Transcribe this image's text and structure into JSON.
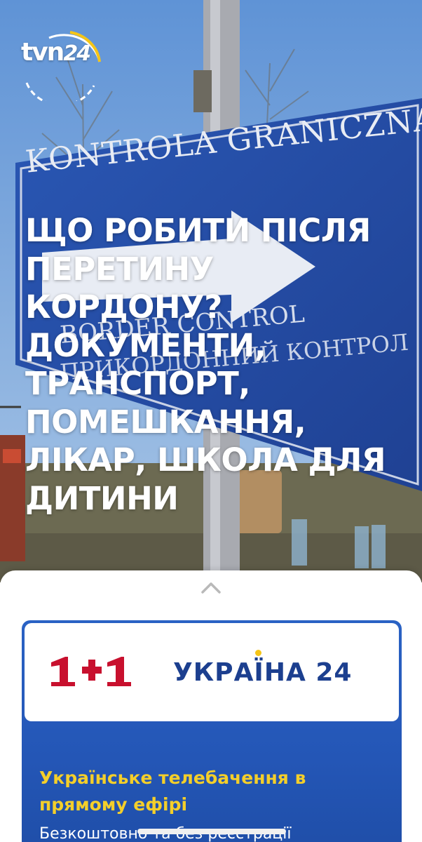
{
  "hero": {
    "sign_main": "KONTROLA GRANICZNA",
    "sign_sub1": "BORDER CONTROL",
    "sign_sub2": "ПРИКОРДОННИЙ КОНТРОЛ"
  },
  "logo": {
    "brand": "tvn",
    "number": "24",
    "icon": "tvn24-logo-icon"
  },
  "headline": "ЩО РОБИТИ ПІСЛЯ ПЕРЕТИНУ КОРДОНУ? ДОКУМЕНТИ, ТРАНСПОРТ, ПОМЕШКАННЯ, ЛІКАР, ШКОЛА ДЛЯ ДИТИНИ",
  "sheet": {
    "handle_icon": "chevron-up-icon",
    "ad": {
      "logo_1plus1": "1+1",
      "logo_ukraina24": "УКРАЇНА 24",
      "title": "Українське телебачення в прямому ефірі",
      "subtitle": "Безкоштовно та без реєстрації"
    }
  },
  "colors": {
    "headline": "#ffffff",
    "ad_bg": "#2456b6",
    "ad_title": "#f4cf2a",
    "logo_1plus1_red": "#c8102e",
    "logo_ukraina24_blue": "#1c3f8f"
  }
}
